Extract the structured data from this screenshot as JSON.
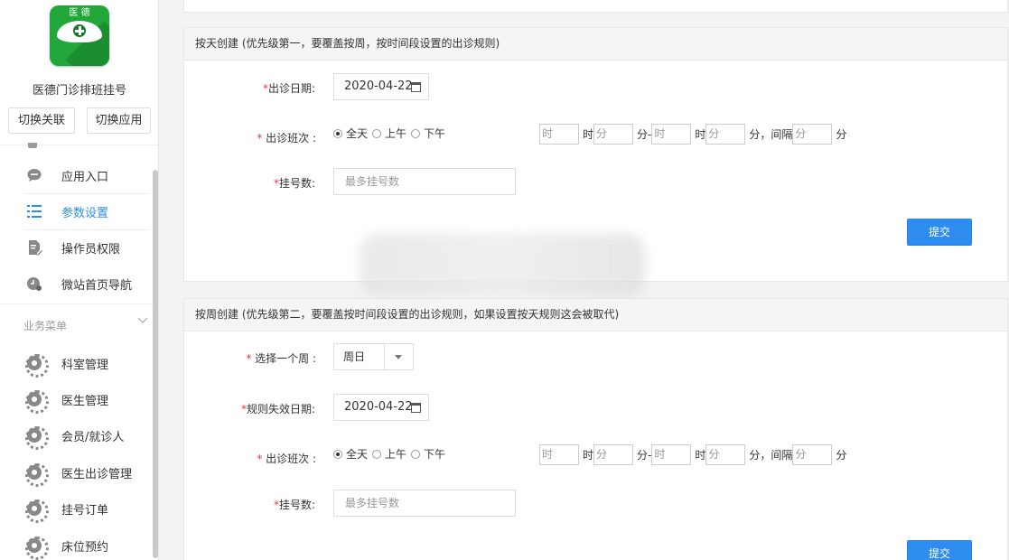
{
  "sidebar": {
    "app_name": "医德门诊排班挂号",
    "logo_text": "医 德",
    "switch_link_label": "切换关联",
    "switch_app_label": "切换应用",
    "items_top": [
      {
        "label": "应用入口",
        "icon": "chat-icon"
      },
      {
        "label": "参数设置",
        "icon": "list-icon",
        "active": true
      },
      {
        "label": "操作员权限",
        "icon": "document-edit-icon"
      },
      {
        "label": "微站首页导航",
        "icon": "clock-user-icon"
      }
    ],
    "section_label": "业务菜单",
    "items_business": [
      {
        "label": "科室管理",
        "icon": "gear-icon"
      },
      {
        "label": "医生管理",
        "icon": "gear-icon"
      },
      {
        "label": "会员/就诊人",
        "icon": "gear-icon"
      },
      {
        "label": "医生出诊管理",
        "icon": "gear-icon"
      },
      {
        "label": "挂号订单",
        "icon": "gear-icon"
      },
      {
        "label": "床位预约",
        "icon": "gear-icon"
      }
    ]
  },
  "colors": {
    "accent": "#2d8cf0",
    "required": "#e4393c",
    "active_nav": "#2a8ff4",
    "logo_green": "#22a83a"
  },
  "by_day": {
    "title": "按天创建 (优先级第一，要覆盖按周，按时间段设置的出诊规则)",
    "date_label": "出诊日期:",
    "date_value": "2020-04-22",
    "shift_label": " 出诊班次 :",
    "shift_options": [
      "全天",
      "上午",
      "下午"
    ],
    "selected_shift": "全天",
    "time": {
      "hour_ph": "时",
      "hour_unit": "时",
      "min_ph": "分",
      "min_unit": "分-",
      "hour2_ph": "时",
      "hour2_unit": "时",
      "min2_ph": "分",
      "interval_unit": "分，间隔",
      "interval_ph": "分",
      "interval_suffix": "分"
    },
    "count_label": "挂号数:",
    "count_placeholder": "最多挂号数",
    "submit_label": "提交"
  },
  "by_week": {
    "title": "按周创建 (优先级第二，要覆盖按时间段设置的出诊规则，如果设置按天规则这会被取代)",
    "week_label": " 选择一个周 :",
    "week_value": "周日",
    "expire_label": "规则失效日期:",
    "expire_value": "2020-04-22",
    "shift_label": " 出诊班次 :",
    "shift_options": [
      "全天",
      "上午",
      "下午"
    ],
    "selected_shift": "全天",
    "time": {
      "hour_ph": "时",
      "hour_unit": "时",
      "min_ph": "分",
      "min_unit": "分-",
      "hour2_ph": "时",
      "hour2_unit": "时",
      "min2_ph": "分",
      "interval_unit": "分，间隔",
      "interval_ph": "分",
      "interval_suffix": "分"
    },
    "count_label": "挂号数:",
    "count_placeholder": "最多挂号数",
    "submit_label": "提交"
  }
}
